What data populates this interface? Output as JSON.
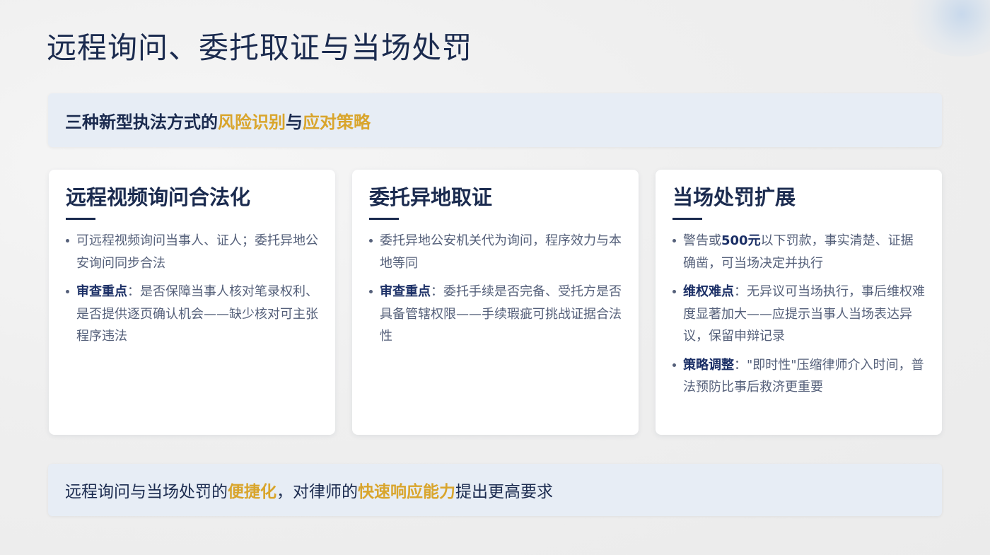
{
  "title": "远程询问、委托取证与当场处罚",
  "banner_top": {
    "before": "三种新型执法方式的",
    "hl1": "风险识别",
    "mid": "与",
    "hl2": "应对策略"
  },
  "cards": [
    {
      "title": "远程视频询问合法化",
      "bullets": [
        {
          "label": "",
          "text": "可远程视频询问当事人、证人；委托异地公安询问同步合法"
        },
        {
          "label": "审查重点",
          "text": "：是否保障当事人核对笔录权利、是否提供逐页确认机会——缺少核对可主张程序违法"
        }
      ]
    },
    {
      "title": "委托异地取证",
      "bullets": [
        {
          "label": "",
          "text": "委托异地公安机关代为询问，程序效力与本地等同"
        },
        {
          "label": "审查重点",
          "text": "：委托手续是否完备、受托方是否具备管辖权限——手续瑕疵可挑战证据合法性"
        }
      ]
    },
    {
      "title": "当场处罚扩展",
      "bullets": [
        {
          "label": "",
          "pre": "警告或",
          "emph": "500元",
          "text": "以下罚款，事实清楚、证据确凿，可当场决定并执行"
        },
        {
          "label": "维权难点",
          "text": "：无异议可当场执行，事后维权难度显著加大——应提示当事人当场表达异议，保留申辩记录"
        },
        {
          "label": "策略调整",
          "text": "：\"即时性\"压缩律师介入时间，普法预防比事后救济更重要"
        }
      ]
    }
  ],
  "banner_bottom": {
    "p1": "远程询问与当场处罚的",
    "hl1": "便捷化",
    "p2": "，对律师的",
    "hl2": "快速响应能力",
    "p3": "提出更高要求"
  },
  "colors": {
    "title": "#1b2b4f",
    "accent": "#d9a52c",
    "banner_bg": "#e7edf5",
    "card_bg": "#ffffff",
    "body_text": "#55607a"
  }
}
